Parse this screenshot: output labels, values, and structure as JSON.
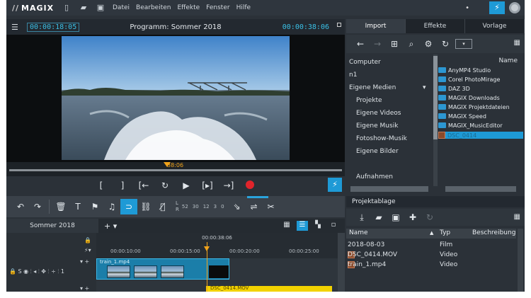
{
  "menubar": {
    "logo": "MAGIX",
    "items": [
      "Datei",
      "Bearbeiten",
      "Effekte",
      "Fenster",
      "Hilfe"
    ]
  },
  "monitor": {
    "timecode_left": "00:00:18:05",
    "title": "Programm: Sommer 2018",
    "timecode_right": "00:00:38:06",
    "scrub_time": "38:06"
  },
  "transport": {
    "mark_in": "[",
    "mark_out": "]"
  },
  "meter": {
    "l": "L",
    "r": "R",
    "scale": [
      "52",
      "30",
      "12",
      "3",
      "0"
    ]
  },
  "timeline": {
    "tab": "Sommer 2018",
    "ruler_top": "00:00:38:06",
    "ticks": [
      "00:00:10:00",
      "00:00:15:00",
      "00:00:20:00",
      "00:00:25:00"
    ],
    "clip1": "train_1.mp4",
    "clip2": "DSC_0414.MOV",
    "track_icons": "S",
    "track_number": "1"
  },
  "media": {
    "tabs": [
      "Import",
      "Effekte",
      "Vorlage"
    ],
    "tree": [
      "Computer",
      "n1",
      "Eigene Medien",
      "Projekte",
      "Eigene Videos",
      "Eigene Musik",
      "Fotoshow-Musik",
      "Eigene Bilder",
      "Aufnahmen"
    ],
    "files_header": "Name",
    "files": [
      "AnyMP4 Studio",
      "Corel PhotoMirage",
      "DAZ 3D",
      "MAGIX Downloads",
      "MAGIX Projektdateien",
      "MAGIX Speed",
      "MAGIX_MusicEditor",
      "DSC_0414"
    ]
  },
  "ablage": {
    "title": "Projektablage",
    "cols": [
      "Name",
      "Typ",
      "Beschreibung"
    ],
    "rows": [
      {
        "name": "2018-08-03",
        "type": "Film"
      },
      {
        "name": "DSC_0414.MOV",
        "type": "Video"
      },
      {
        "name": "train_1.mp4",
        "type": "Video"
      }
    ]
  },
  "colors": {
    "accent": "#1e9ad6",
    "timecode": "#3ac0e6",
    "playhead": "#f1a31b",
    "record": "#e0242b",
    "clip_yellow": "#f2d200"
  }
}
